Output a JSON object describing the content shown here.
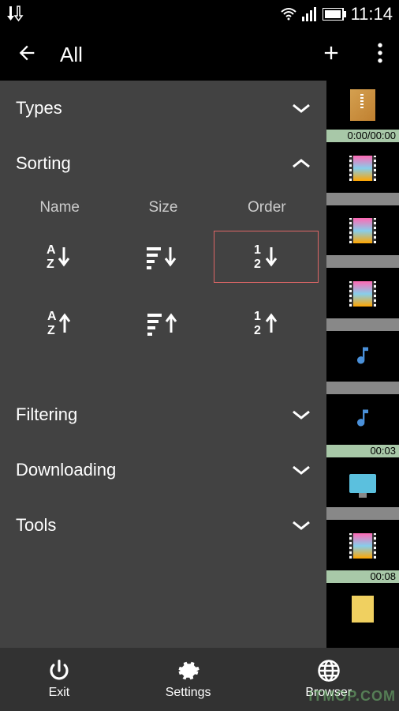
{
  "status_bar": {
    "time": "11:14"
  },
  "app_bar": {
    "title": "All"
  },
  "panel": {
    "types_label": "Types",
    "sorting_label": "Sorting",
    "filtering_label": "Filtering",
    "downloading_label": "Downloading",
    "tools_label": "Tools",
    "sort_headers": {
      "name": "Name",
      "size": "Size",
      "order": "Order"
    }
  },
  "strip_items": [
    {
      "type": "zip",
      "time": "0:00/00:00",
      "time_class": "green"
    },
    {
      "type": "film",
      "time": "",
      "time_class": "gray"
    },
    {
      "type": "film",
      "time": "",
      "time_class": "gray"
    },
    {
      "type": "film",
      "time": "",
      "time_class": "gray"
    },
    {
      "type": "music",
      "time": "",
      "time_class": "gray"
    },
    {
      "type": "music",
      "time": "00:03",
      "time_class": "green"
    },
    {
      "type": "monitor",
      "time": "",
      "time_class": "gray"
    },
    {
      "type": "film",
      "time": "00:08",
      "time_class": "green"
    },
    {
      "type": "doc",
      "time": "",
      "time_class": ""
    }
  ],
  "bottom_nav": {
    "exit": "Exit",
    "settings": "Settings",
    "browser": "Browser"
  },
  "watermark": "ITMOP.COM"
}
